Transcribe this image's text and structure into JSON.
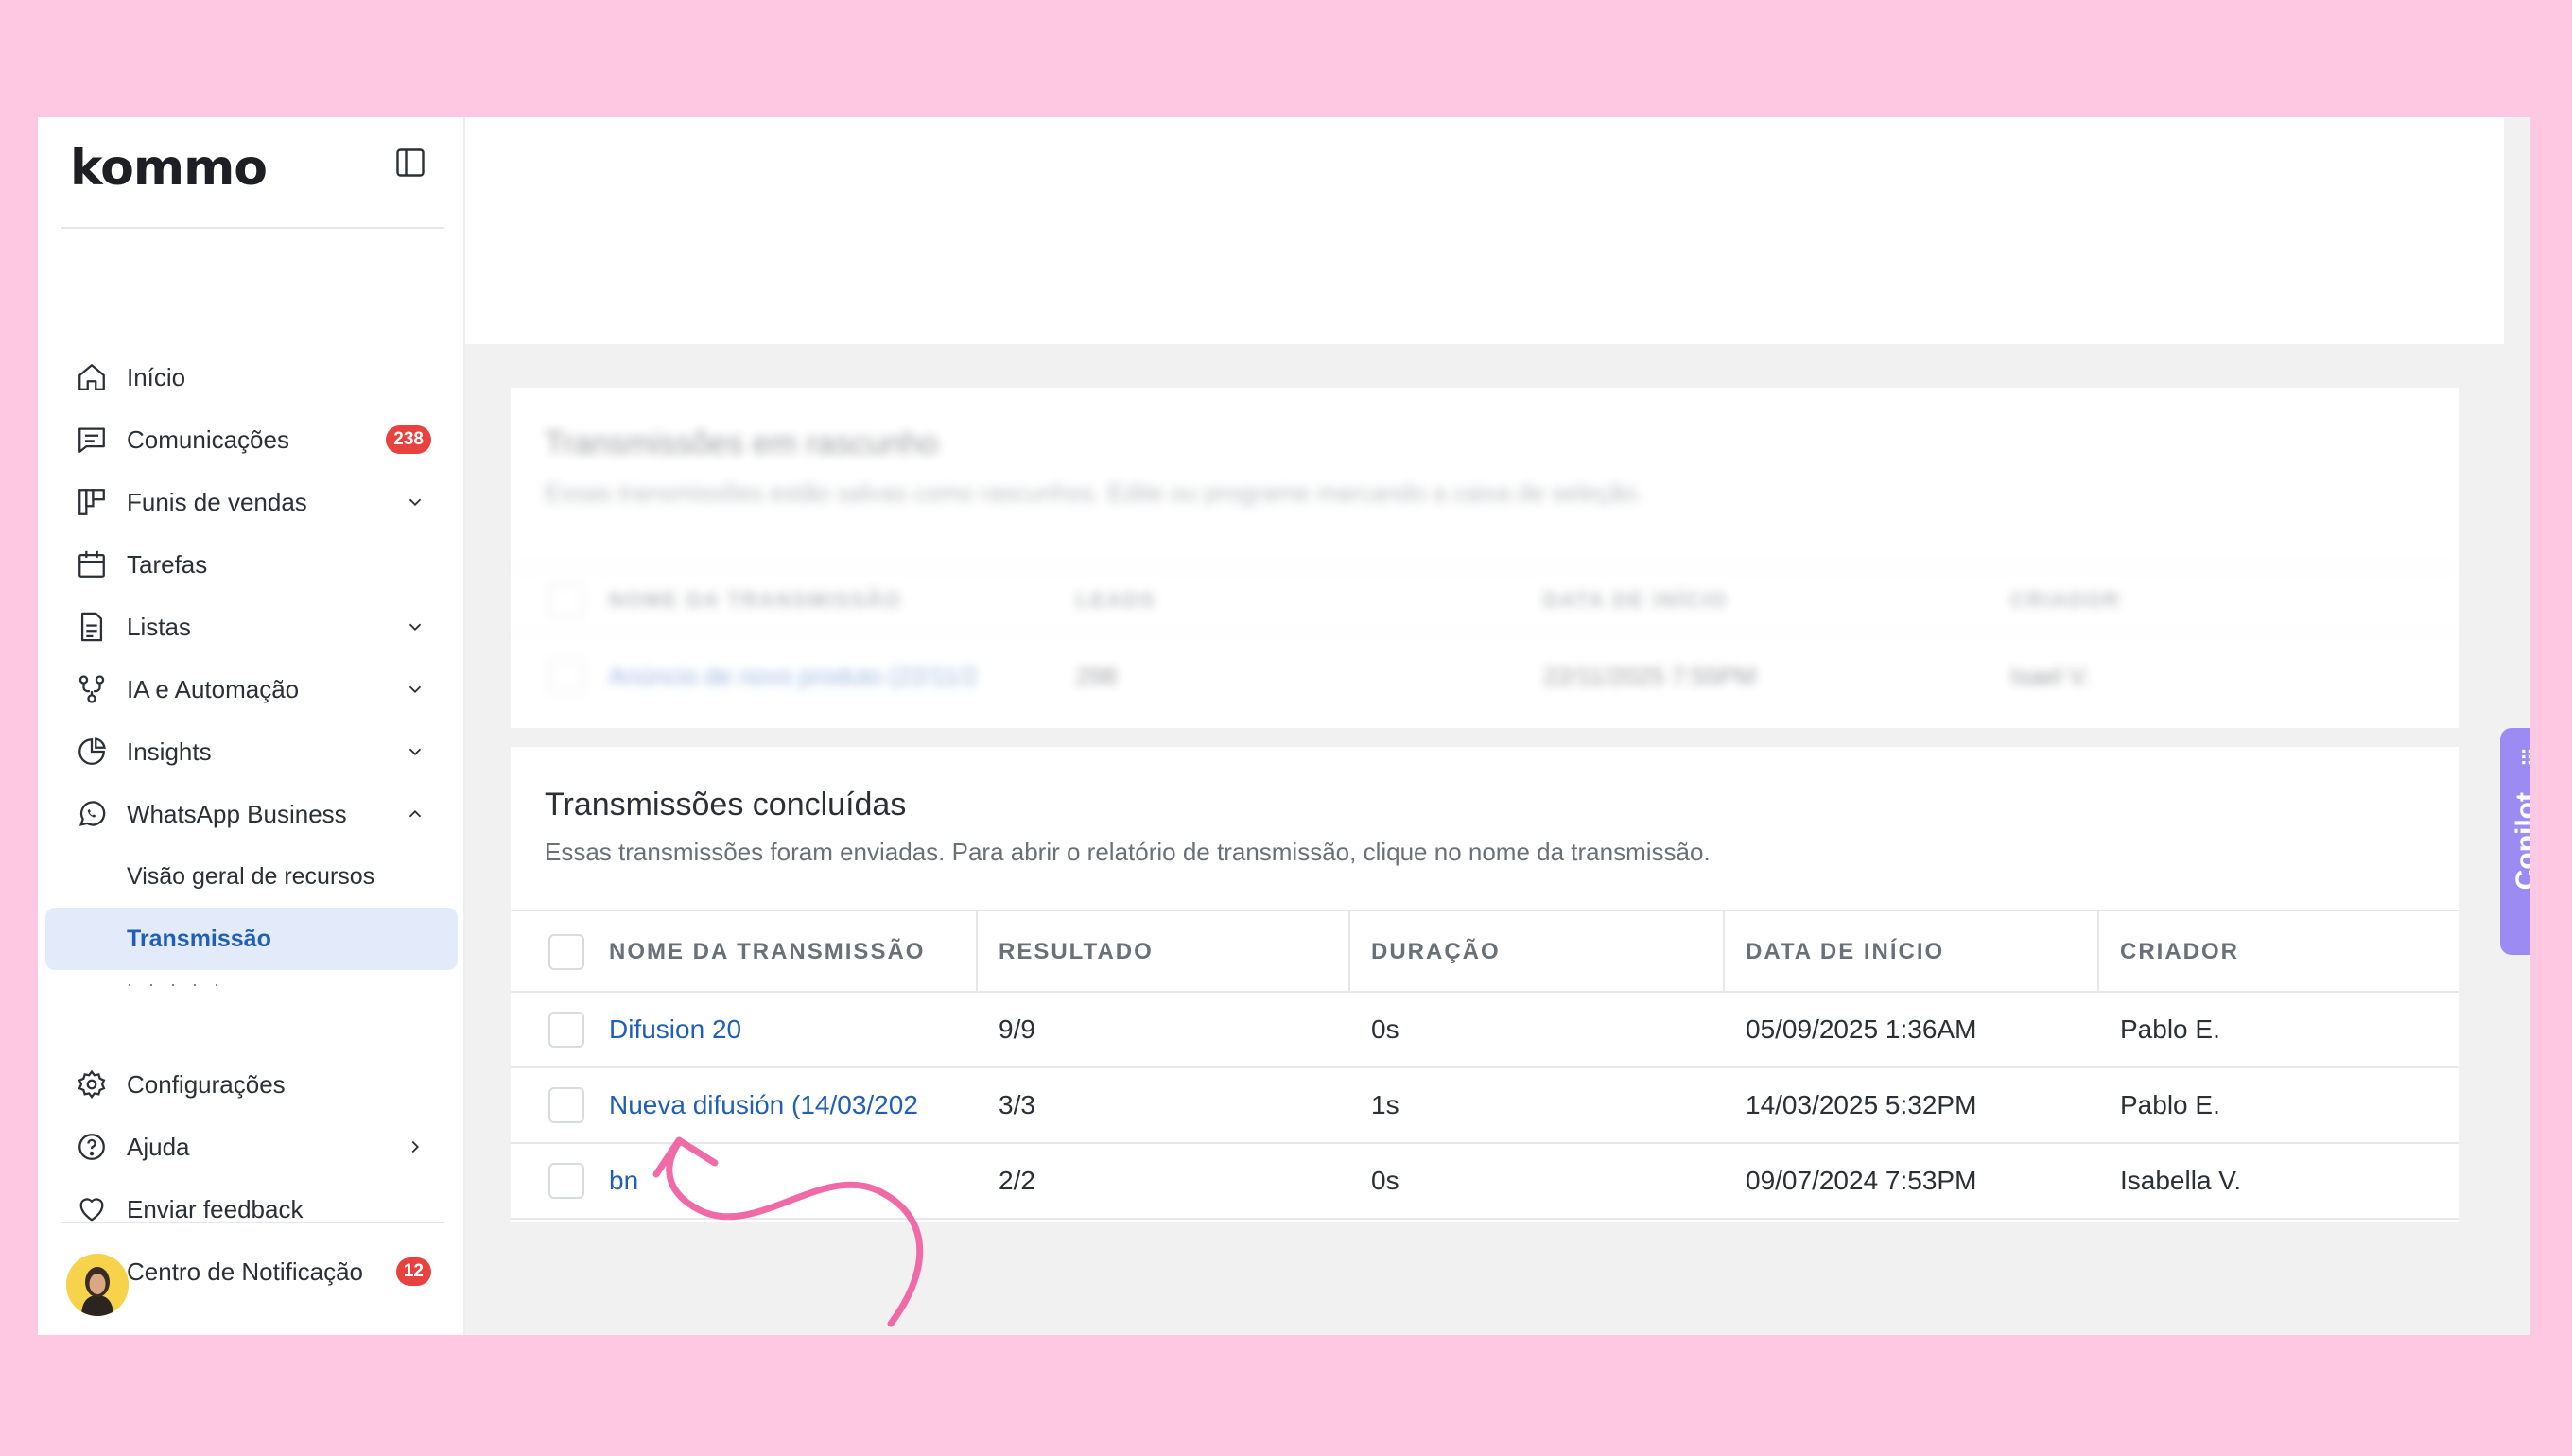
{
  "brand": {
    "logo": "kommo"
  },
  "sidebar": {
    "items": [
      {
        "label": "Início",
        "icon": "home-icon"
      },
      {
        "label": "Comunicações",
        "icon": "chat-icon",
        "badge": "238"
      },
      {
        "label": "Funis de vendas",
        "icon": "pipeline-icon",
        "chevron": "down"
      },
      {
        "label": "Tarefas",
        "icon": "calendar-icon"
      },
      {
        "label": "Listas",
        "icon": "list-icon",
        "chevron": "down"
      },
      {
        "label": "IA e Automação",
        "icon": "automation-icon",
        "chevron": "down"
      },
      {
        "label": "Insights",
        "icon": "pie-chart-icon",
        "chevron": "down"
      },
      {
        "label": "WhatsApp Business",
        "icon": "whatsapp-icon",
        "chevron": "up"
      }
    ],
    "subitems": [
      {
        "label": "Visão geral de recursos"
      },
      {
        "label": "Transmissão",
        "active": true
      },
      {
        "label": "· · · · ·"
      }
    ],
    "bottom_items": [
      {
        "label": "Configurações",
        "icon": "gear-icon"
      },
      {
        "label": "Ajuda",
        "icon": "help-icon",
        "chevron": "right"
      },
      {
        "label": "Enviar feedback",
        "icon": "heart-icon"
      },
      {
        "label": "Centro de Notificação",
        "icon": "bell-icon",
        "badge": "12"
      }
    ]
  },
  "drafts": {
    "title": "Transmissões em rascunho",
    "subtitle": "Essas transmissões estão salvas como rascunhos. Edite ou programe marcando a caixa de seleção.",
    "columns": [
      "NOME DA TRANSMISSÃO",
      "LEADS",
      "DATA DE INÍCIO",
      "CRIADOR"
    ],
    "row": [
      "Anúncio de novo produto (22/11/2",
      "298",
      "22/11/2025 7:55PM",
      "Isael V."
    ]
  },
  "completed": {
    "title": "Transmissões concluídas",
    "subtitle": "Essas transmissões foram enviadas. Para abrir o relatório de transmissão, clique no nome da transmissão.",
    "columns": {
      "name": "NOME DA TRANSMISSÃO",
      "result": "RESULTADO",
      "duration": "DURAÇÃO",
      "start": "DATA DE INÍCIO",
      "creator": "CRIADOR"
    },
    "rows": [
      {
        "name": "Difusion 20",
        "result": "9/9",
        "duration": "0s",
        "start": "05/09/2025 1:36AM",
        "creator": "Pablo E."
      },
      {
        "name": "Nueva difusión (14/03/202",
        "result": "3/3",
        "duration": "1s",
        "start": "14/03/2025 5:32PM",
        "creator": "Pablo E."
      },
      {
        "name": "bn",
        "result": "2/2",
        "duration": "0s",
        "start": "09/07/2024 7:53PM",
        "creator": "Isabella V."
      }
    ]
  },
  "copilot": {
    "label": "Copilot"
  },
  "colors": {
    "accent": "#1f5fb8",
    "badge": "#e8423f",
    "copilot": "#9c8bf2",
    "background": "#ffc8e2",
    "annotation": "#f06aa8"
  }
}
